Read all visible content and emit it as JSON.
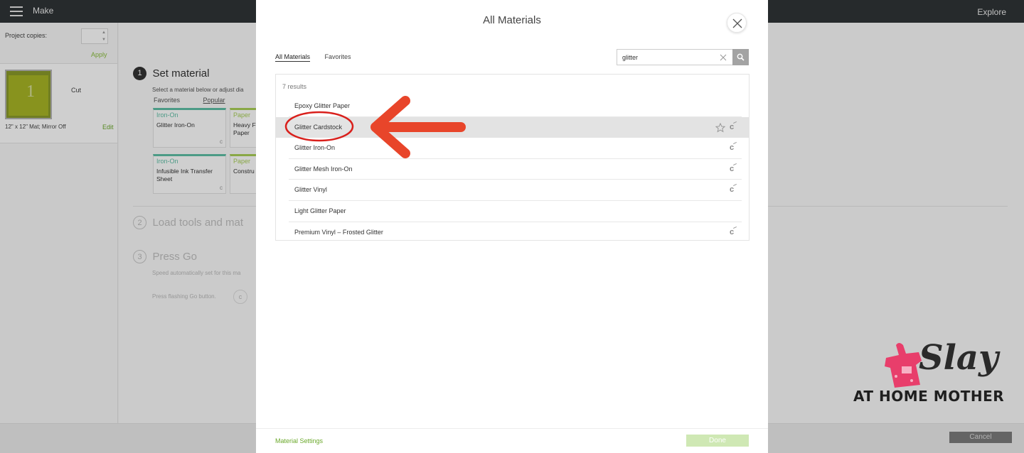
{
  "app": {
    "title": "Make",
    "explore_label": "Explore"
  },
  "left_panel": {
    "project_copies_label": "Project copies:",
    "apply_label": "Apply",
    "mat": {
      "number": "1",
      "cut_label": "Cut",
      "info": "12\" x 12\" Mat; Mirror Off",
      "edit_label": "Edit"
    }
  },
  "main": {
    "step1": {
      "number": "1",
      "heading": "Set material",
      "subtext": "Select a material below or adjust dia"
    },
    "material_tabs": [
      "Favorites",
      "Popular"
    ],
    "tiles": [
      {
        "category": "Iron-On",
        "name": "Glitter Iron-On",
        "badge": "c"
      },
      {
        "category": "Paper",
        "name": "Heavy F\nPaper",
        "badge": ""
      },
      {
        "category": "Iron-On",
        "name": "Infusible Ink Transfer\nSheet",
        "badge": "c"
      },
      {
        "category": "Paper",
        "name": "Constru",
        "badge": ""
      }
    ],
    "step2": {
      "number": "2",
      "heading": "Load tools and mat"
    },
    "step3": {
      "number": "3",
      "heading": "Press Go",
      "speed_text": "Speed automatically set for this ma",
      "press_text": "Press flashing Go button.",
      "go_icon": "c"
    },
    "cancel_label": "Cancel"
  },
  "modal": {
    "title": "All Materials",
    "tabs": [
      {
        "label": "All Materials",
        "active": true
      },
      {
        "label": "Favorites",
        "active": false
      }
    ],
    "search": {
      "value": "glitter",
      "placeholder": ""
    },
    "results_count": "7 results",
    "results": [
      {
        "name": "Epoxy Glitter Paper",
        "selected": false,
        "star": false,
        "cricut_badge": ""
      },
      {
        "name": "Glitter Cardstock",
        "selected": true,
        "star": true,
        "cricut_badge": "c"
      },
      {
        "name": "Glitter Iron-On",
        "selected": false,
        "star": false,
        "cricut_badge": "c"
      },
      {
        "name": "Glitter Mesh Iron-On",
        "selected": false,
        "star": false,
        "cricut_badge": "c"
      },
      {
        "name": "Glitter Vinyl",
        "selected": false,
        "star": false,
        "cricut_badge": "c"
      },
      {
        "name": "Light Glitter Paper",
        "selected": false,
        "star": false,
        "cricut_badge": ""
      },
      {
        "name": "Premium Vinyl – Frosted Glitter",
        "selected": false,
        "star": false,
        "cricut_badge": "c"
      }
    ],
    "material_settings_label": "Material Settings",
    "done_label": "Done"
  },
  "annotation": {
    "color": "#e8452a",
    "ring_color": "#d9201c"
  },
  "watermark": {
    "line1": "Slay",
    "line2": "AT HOME MOTHER",
    "accent": "#e83e6b"
  },
  "colors": {
    "topbar": "#2f3437",
    "accent_green": "#6aa82a",
    "ironon_teal": "#5ebfa5",
    "paper_green": "#a9cf57"
  }
}
